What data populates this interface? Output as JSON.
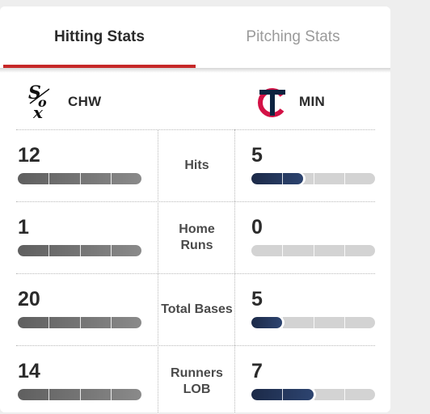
{
  "tabs": [
    {
      "label": "Hitting Stats",
      "active": true
    },
    {
      "label": "Pitching Stats",
      "active": false
    }
  ],
  "colors": {
    "active_tab_underline": "#c62828",
    "chw_bar": "#6f6f6f",
    "min_bar": "#1c2a48",
    "bar_track": "#d3d3d3",
    "twins_red": "#d31145",
    "twins_navy": "#0c2340"
  },
  "teams": {
    "left": {
      "abbr": "CHW",
      "logo": "white-sox-logo"
    },
    "right": {
      "abbr": "MIN",
      "logo": "twins-logo"
    }
  },
  "stats": [
    {
      "label": "Hits",
      "left": "12",
      "right": "5",
      "left_fill": 1.0,
      "right_fill": 0.42
    },
    {
      "label": "Home\nRuns",
      "left": "1",
      "right": "0",
      "left_fill": 1.0,
      "right_fill": 0.0
    },
    {
      "label": "Total Bases",
      "left": "20",
      "right": "5",
      "left_fill": 1.0,
      "right_fill": 0.25
    },
    {
      "label": "Runners\nLOB",
      "left": "14",
      "right": "7",
      "left_fill": 1.0,
      "right_fill": 0.5
    }
  ]
}
